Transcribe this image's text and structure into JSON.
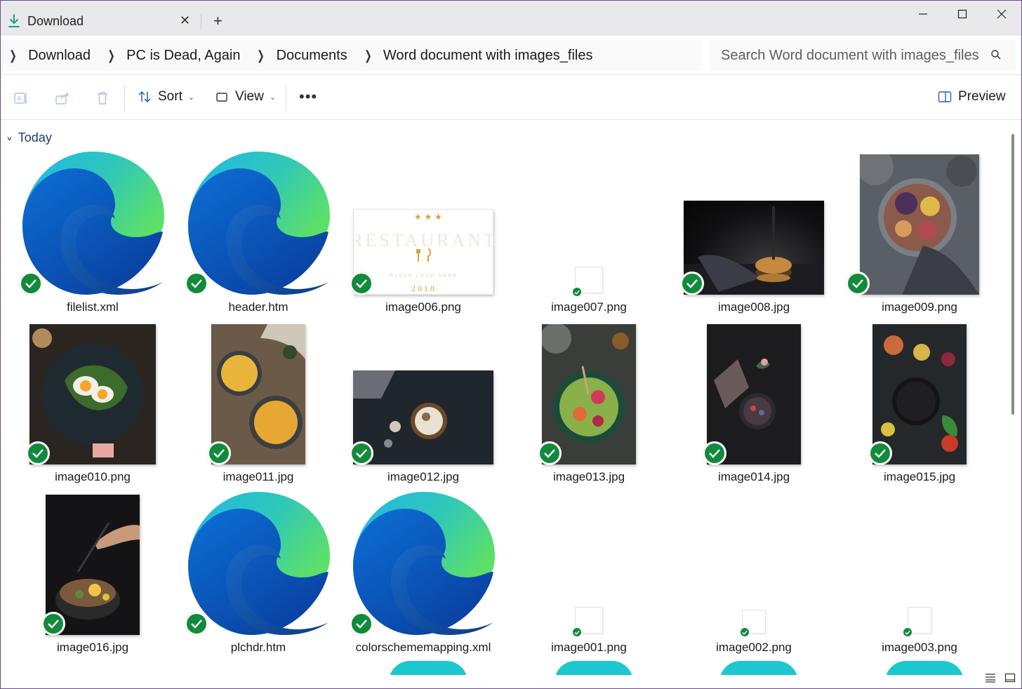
{
  "window": {
    "tab": {
      "label": "Download",
      "icon": "download-icon"
    },
    "controls": [
      "minimize",
      "maximize",
      "close"
    ]
  },
  "address": {
    "crumbs": [
      "Download",
      "PC is Dead, Again",
      "Documents",
      "Word document with images_files"
    ],
    "search_placeholder": "Search Word document with images_files"
  },
  "toolbar": {
    "sort_label": "Sort",
    "view_label": "View",
    "more_label": "•••",
    "preview_label": "Preview"
  },
  "group": {
    "label": "Today"
  },
  "files": [
    {
      "name": "filelist.xml",
      "kind": "edge"
    },
    {
      "name": "header.htm",
      "kind": "edge"
    },
    {
      "name": "image006.png",
      "kind": "logo"
    },
    {
      "name": "image007.png",
      "kind": "blank"
    },
    {
      "name": "image008.jpg",
      "kind": "photo-burger"
    },
    {
      "name": "image009.png",
      "kind": "photo-platter"
    },
    {
      "name": "image010.png",
      "kind": "photo-eggs"
    },
    {
      "name": "image011.jpg",
      "kind": "photo-soup"
    },
    {
      "name": "image012.jpg",
      "kind": "photo-dessert"
    },
    {
      "name": "image013.jpg",
      "kind": "photo-salad"
    },
    {
      "name": "image014.jpg",
      "kind": "photo-dark"
    },
    {
      "name": "image015.jpg",
      "kind": "photo-pan"
    },
    {
      "name": "image016.jpg",
      "kind": "photo-ramen"
    },
    {
      "name": "plchdr.htm",
      "kind": "edge"
    },
    {
      "name": "colorschememapping.xml",
      "kind": "edge"
    },
    {
      "name": "image001.png",
      "kind": "blank"
    },
    {
      "name": "image002.png",
      "kind": "blank"
    },
    {
      "name": "image003.png",
      "kind": "blank"
    }
  ],
  "logo_thumb": {
    "line1": "RESTAURANT",
    "line2": "PLACE LOGO HERE",
    "year": "2018"
  },
  "colors": {
    "sync": "#128a3c",
    "accent": "#1d3d7a",
    "edge_cyan": "#1cc7d0"
  }
}
